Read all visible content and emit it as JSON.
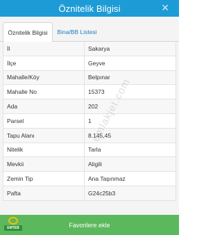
{
  "header": {
    "title": "Öznitelik Bilgisi",
    "close_glyph": "✕"
  },
  "tabs": [
    {
      "label": "Öznitelik Bilgisi",
      "active": true
    },
    {
      "label": "Bina/BB Listesi",
      "active": false
    }
  ],
  "attributes": [
    {
      "key": "İl",
      "value": "Sakarya"
    },
    {
      "key": "İlçe",
      "value": "Geyve"
    },
    {
      "key": "Mahalle/Köy",
      "value": "Belpınar"
    },
    {
      "key": "Mahalle No",
      "value": "15373"
    },
    {
      "key": "Ada",
      "value": "202"
    },
    {
      "key": "Parsel",
      "value": "1"
    },
    {
      "key": "Tapu Alanı",
      "value": "8.145,45"
    },
    {
      "key": "Nitelik",
      "value": "Tarla"
    },
    {
      "key": "Mevkii",
      "value": "Aligili"
    },
    {
      "key": "Zemin Tip",
      "value": "Ana Taşınmaz"
    },
    {
      "key": "Pafta",
      "value": "G24c25b3"
    }
  ],
  "watermark": "emlakjet.com",
  "logo_text": "EMTEB",
  "favorites_button": "Favorilere ekle",
  "colors": {
    "header_bg": "#1c9bd6",
    "button_bg": "#5cb85c",
    "tab_link": "#1c7fc0"
  }
}
